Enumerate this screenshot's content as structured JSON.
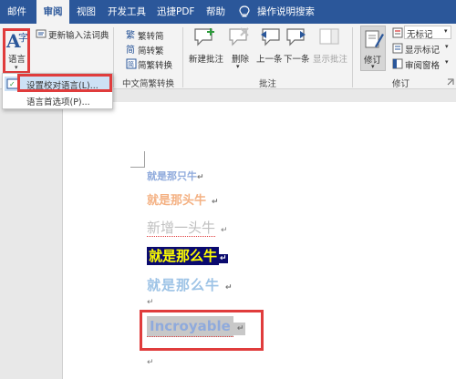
{
  "tabs": [
    {
      "label": "邮件"
    },
    {
      "label": "审阅"
    },
    {
      "label": "视图"
    },
    {
      "label": "开发工具"
    },
    {
      "label": "迅捷PDF"
    },
    {
      "label": "帮助"
    },
    {
      "label": "操作说明搜索"
    }
  ],
  "ribbon": {
    "language": {
      "button": "语言",
      "update_ime": "更新输入法词典"
    },
    "chinese": {
      "to_traditional": "繁转简",
      "to_simplified": "简转繁",
      "convert": "简繁转换",
      "group": "中文简繁转换"
    },
    "comments": {
      "new": "新建批注",
      "delete": "删除",
      "prev": "上一条",
      "next": "下一条",
      "show": "显示批注",
      "group": "批注"
    },
    "tracking": {
      "track": "修订",
      "markup": "无标记",
      "show_markup": "显示标记",
      "pane": "审阅窗格",
      "group": "修订"
    }
  },
  "dropdown": {
    "items": [
      {
        "label": "设置校对语言(L)..."
      },
      {
        "label": "语言首选项(P)..."
      }
    ]
  },
  "document": {
    "lines": [
      {
        "text": "就是那只牛",
        "color": "#8faadc"
      },
      {
        "text": "就是那头牛",
        "color": "#f4b183"
      },
      {
        "text": "新增一头牛",
        "color": "#bfbfbf"
      },
      {
        "text": "就是那么牛",
        "color": "#ffff00",
        "bg": "#0a0a6e"
      },
      {
        "text": "就是那么牛",
        "color": "#9dc3e6"
      },
      {
        "text": "Incroyable",
        "color": "#8faadc",
        "bg": "#c8c8c8"
      }
    ]
  },
  "colors": {
    "ribbon_blue": "#2b579a",
    "highlight_red": "#e03c3c"
  }
}
